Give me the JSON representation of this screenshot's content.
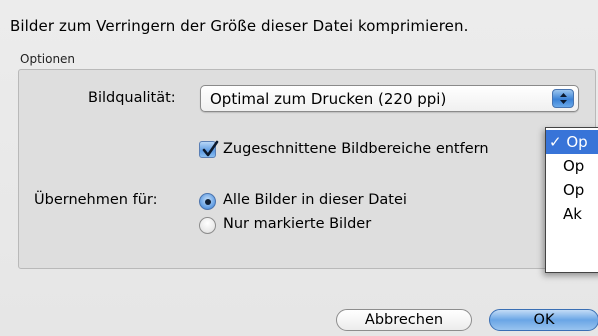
{
  "dialog": {
    "headline": "Bilder zum Verringern der Größe dieser Datei komprimieren.",
    "group_caption": "Optionen"
  },
  "quality": {
    "label": "Bildqualität:",
    "selected": "Optimal zum Drucken (220 ppi)",
    "arrows_icon": "up-down-chevron-icon"
  },
  "crop": {
    "label": "Zugeschnittene Bildbereiche entfern",
    "checked": true
  },
  "apply": {
    "label": "Übernehmen für:",
    "options": [
      {
        "label": "Alle Bilder in dieser Datei",
        "selected": true
      },
      {
        "label": "Nur markierte Bilder",
        "selected": false
      }
    ]
  },
  "menu": {
    "items": [
      "✓ Op",
      "Op",
      "Op",
      "Ak"
    ]
  },
  "buttons": {
    "cancel": "Abbrechen",
    "ok": "OK"
  },
  "colors": {
    "accent": "#3874d8",
    "dialog_bg": "#e8e8e8",
    "group_bg": "#dedede"
  }
}
